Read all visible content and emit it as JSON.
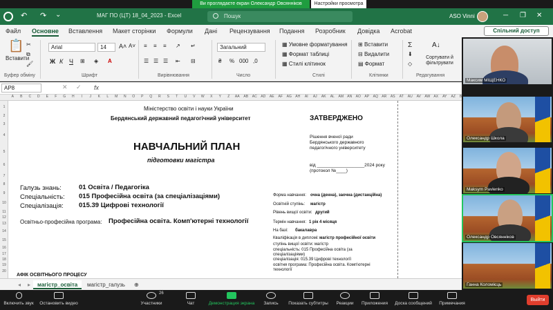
{
  "zoom": {
    "banner_text": "Ви проглядаєте екран Олександр Овсянніков",
    "banner_options": "Настройки просмотра",
    "toolbar": {
      "mute": "Включить звук",
      "video": "Остановить видео",
      "participants": "Участники",
      "participants_count": "26",
      "chat": "Чат",
      "share": "Демонстрация экрана",
      "record": "Запись",
      "captions": "Показать субтитры",
      "reactions": "Реакции",
      "apps": "Приложения",
      "whiteboard": "Доска сообщений",
      "notes": "Примечания",
      "leave": "Выйти"
    },
    "participants": [
      {
        "name": "Максим МІЩЕНКО",
        "bg": "office"
      },
      {
        "name": "Олександр Школа",
        "bg": "uni"
      },
      {
        "name": "Maksym Pavlenko",
        "bg": "uni"
      },
      {
        "name": "Олександр Овсянніков",
        "bg": "uni"
      },
      {
        "name": "Ганна Коломієць",
        "bg": "uni"
      }
    ]
  },
  "excel": {
    "title": "МАГ ПО (ЦТ) 18_04_2023  -  Excel",
    "search_placeholder": "Пошук",
    "user": "ASO Vinni",
    "tabs": [
      "Файл",
      "Основне",
      "Вставлення",
      "Макет сторінки",
      "Формули",
      "Дані",
      "Рецензування",
      "Подання",
      "Розробник",
      "Довідка",
      "Acrobat"
    ],
    "active_tab": "Основне",
    "share_label": "Спільний доступ",
    "ribbon": {
      "paste": "Вставити",
      "clipboard": "Буфер обміну",
      "font_name": "Arial",
      "font_size": "14",
      "font_group": "Шрифт",
      "align_group": "Вирівнювання",
      "number_format": "Загальний",
      "number_group": "Число",
      "cond_format": "Умовне форматування",
      "table_format": "Формат таблиці",
      "cell_styles": "Стилі клітинок",
      "styles_group": "Стилі",
      "insert": "Вставити",
      "delete": "Видалити",
      "format": "Формат",
      "cells_group": "Клітинки",
      "sort": "Сортувати й фільтрувати",
      "editing_group": "Редагування"
    },
    "name_box": "AP8",
    "fx": "fx",
    "columns": "A B C D E F G H I J K L M N O P Q R S T U V W X Y Z AA AB AC AD AE AF AG AH AI AJ AK AL AM AN AO AP AQ AR AS AT AU AV AW AX AY AZ BA BB BC BD BE",
    "sheet_tabs": [
      "магістр_освіта",
      "магістр_галузь"
    ],
    "active_sheet": "магістр_освіта",
    "cells": {
      "ministry": "Міністерство освіти і науки України",
      "university": "Бердянський державний педагогічний університет",
      "approved": "ЗАТВЕРДЖЕНО",
      "plan": "НАВЧАЛЬНИЙ ПЛАН",
      "plan_sub": "підготовки магістра",
      "council1": "Рішення вченої ради",
      "council2": "Бердянського державного",
      "council3": "педагогічного університету",
      "from": "від ___________________2024 року",
      "protocol": "(протокол №____)",
      "field_label": "Галузь знань:",
      "field_value": "01 Освіта / Педагогіка",
      "spec_label": "Спеціальність:",
      "spec_value": "015 Професійна освіта (за спеціалізаціями)",
      "spez_label": "Спеціалізація:",
      "spez_value": "015.39 Цифрові технології",
      "program_label": "Освітньо-професійна програма:",
      "program_value": "Професійна освіта. Комп'ютерні технології",
      "form_label": "Форма навчання:",
      "form_value": "очна (денна), заочна (дистанційна)",
      "degree_label": "Освітній ступінь:",
      "degree_value": "магістр",
      "level_label": "Рівень вищої освіти:",
      "level_value": "другий",
      "term_label": "Термін навчання:",
      "term_value": "1 рік 4 місяця",
      "base_label": "На базі:",
      "base_value": "бакалавра",
      "qual_label": "Кваліфікація в дипломі:",
      "qual_value": "магістр професійної освіти",
      "q_degree": "ступінь вищої освіти: магістр",
      "q_spec1": "спеціальність: 015 Професійна освіта (за",
      "q_spec2": "спеціалізаціями)",
      "q_spez": "спеціалізація: 015.39 Цифрові технології",
      "q_prog1": "освітня програма: Професійна освіта. Комп'ютерні",
      "q_prog2": "технології",
      "schedule": "АФІК ОСВІТНЬОГО ПРОЦЕСУ"
    }
  }
}
